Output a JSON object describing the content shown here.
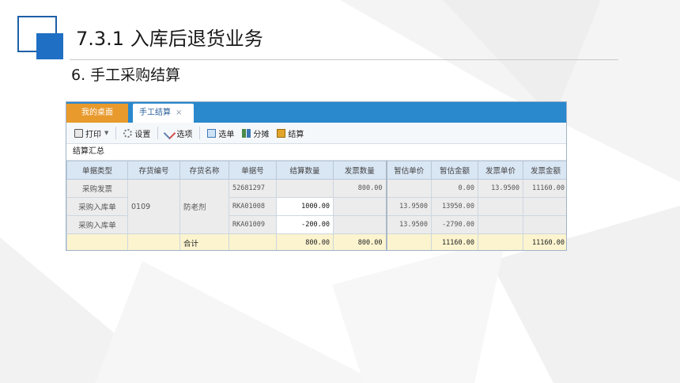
{
  "slide": {
    "title": "7.3.1  入库后退货业务",
    "subtitle": "6. 手工采购结算"
  },
  "app": {
    "tabs": [
      {
        "label": "我的桌面"
      },
      {
        "label": "手工结算",
        "close": "×"
      }
    ],
    "toolbar": {
      "print": "打印",
      "settings": "设置",
      "options": "选项",
      "select_doc": "选单",
      "allocate": "分摊",
      "settle": "结算"
    },
    "section_title": "结算汇总",
    "columns": [
      "单据类型",
      "存货编号",
      "存货名称",
      "单据号",
      "结算数量",
      "发票数量",
      "暂估单价",
      "暂估金额",
      "发票单价",
      "发票金额"
    ],
    "rows": [
      {
        "doc_type": "采购发票",
        "inv_code": "",
        "inv_name": "",
        "doc_no": "52681297",
        "settle_qty": "",
        "invoice_qty": "800.00",
        "est_price": "",
        "est_amount": "0.00",
        "inv_price": "13.9500",
        "inv_amount": "11160.00"
      },
      {
        "doc_type": "采购入库单",
        "inv_code": "0109",
        "inv_name": "防老剂",
        "doc_no": "RKA01008",
        "settle_qty": "1000.00",
        "invoice_qty": "",
        "est_price": "13.9500",
        "est_amount": "13950.00",
        "inv_price": "",
        "inv_amount": ""
      },
      {
        "doc_type": "采购入库单",
        "inv_code": "",
        "inv_name": "",
        "doc_no": "RKA01009",
        "settle_qty": "-200.00",
        "invoice_qty": "",
        "est_price": "13.9500",
        "est_amount": "-2790.00",
        "inv_price": "",
        "inv_amount": ""
      }
    ],
    "total": {
      "label": "合计",
      "settle_qty": "800.00",
      "invoice_qty": "800.00",
      "est_amount": "11160.00",
      "inv_amount": "11160.00"
    }
  }
}
